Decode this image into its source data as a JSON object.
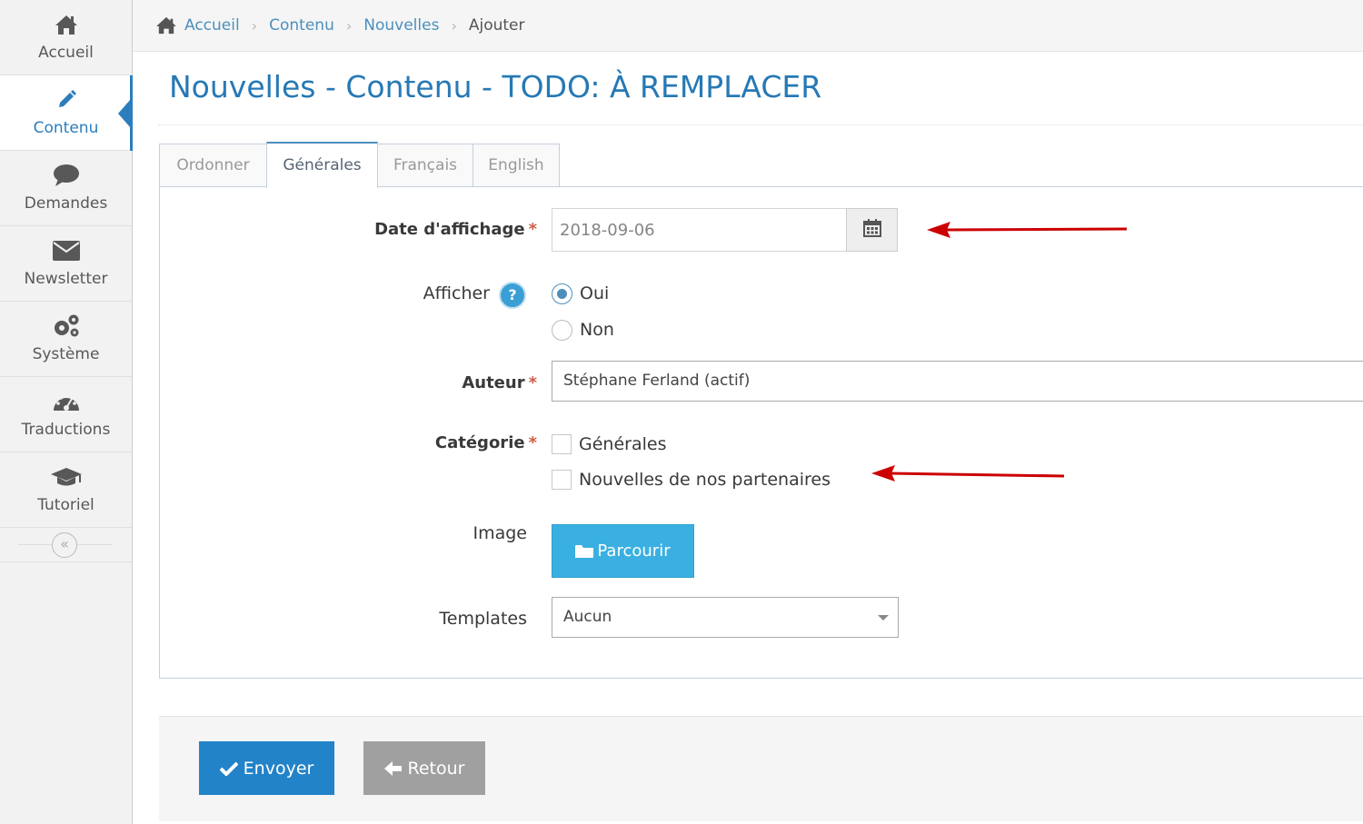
{
  "sidebar": {
    "items": [
      {
        "label": "Accueil",
        "icon": "home-icon"
      },
      {
        "label": "Contenu",
        "icon": "pencil-icon",
        "active": true
      },
      {
        "label": "Demandes",
        "icon": "chat-bubble-icon"
      },
      {
        "label": "Newsletter",
        "icon": "envelope-icon"
      },
      {
        "label": "Système",
        "icon": "gears-icon"
      },
      {
        "label": "Traductions",
        "icon": "dashboard-icon"
      },
      {
        "label": "Tutoriel",
        "icon": "graduation-cap-icon"
      }
    ],
    "collapse_glyph": "«"
  },
  "breadcrumb": {
    "items": [
      "Accueil",
      "Contenu",
      "Nouvelles"
    ],
    "current": "Ajouter",
    "separator": "›"
  },
  "page": {
    "title": "Nouvelles - Contenu - TODO: À REMPLACER"
  },
  "tabs": [
    {
      "label": "Ordonner"
    },
    {
      "label": "Générales",
      "active": true
    },
    {
      "label": "Français"
    },
    {
      "label": "English"
    }
  ],
  "form": {
    "date": {
      "label": "Date d'affichage",
      "required_mark": "*",
      "value": "2018-09-06"
    },
    "afficher": {
      "label": "Afficher",
      "help_glyph": "?",
      "options": [
        {
          "label": "Oui",
          "checked": true
        },
        {
          "label": "Non",
          "checked": false
        }
      ]
    },
    "auteur": {
      "label": "Auteur",
      "required_mark": "*",
      "value": "Stéphane Ferland (actif)"
    },
    "categorie": {
      "label": "Catégorie",
      "required_mark": "*",
      "options": [
        {
          "label": "Générales",
          "checked": false
        },
        {
          "label": "Nouvelles de nos partenaires",
          "checked": false
        }
      ]
    },
    "image": {
      "label": "Image",
      "button_label": "Parcourir"
    },
    "templates": {
      "label": "Templates",
      "value": "Aucun"
    }
  },
  "actions": {
    "submit_label": "Envoyer",
    "back_label": "Retour"
  },
  "colors": {
    "accent": "#2679b5",
    "primary_button": "#2283c8",
    "browse_button": "#3ab0e2",
    "annotation_arrow": "#cc0000",
    "required": "#d15b47"
  }
}
